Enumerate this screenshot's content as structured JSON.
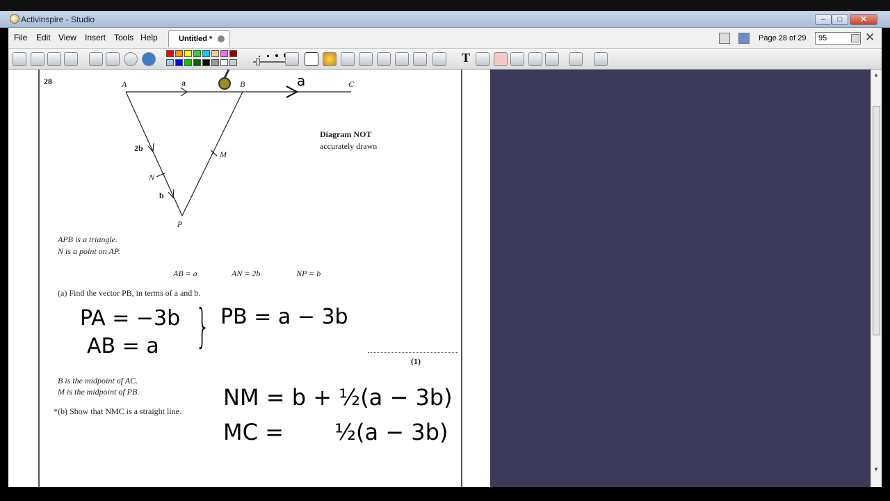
{
  "window": {
    "title": "Activinspire - Studio"
  },
  "menu": {
    "items": [
      "File",
      "Edit",
      "View",
      "Insert",
      "Tools",
      "Help"
    ]
  },
  "tab": {
    "label": "Untitled *"
  },
  "pager": {
    "label": "Page 28 of 29",
    "zoom": "95"
  },
  "colors": {
    "palette": [
      "#ff0000",
      "#ff9900",
      "#ffff00",
      "#33cc33",
      "#00ccff",
      "#ffcc99",
      "#ff66ff",
      "#990000",
      "#99ccff",
      "#0000ff",
      "#00cc00",
      "#006600",
      "#000000",
      "#999999",
      "#ffffff",
      "#cccccc"
    ],
    "right_panel": "#3b3a58"
  },
  "question": {
    "number": "28",
    "points": {
      "A": "A",
      "B": "B",
      "C": "C",
      "N": "N",
      "M": "M",
      "P": "P"
    },
    "edge_labels": {
      "a": "a",
      "two_b": "2b",
      "b": "b"
    },
    "diagram_note_line1": "Diagram NOT",
    "diagram_note_line2": "accurately drawn",
    "stmt1": "APB is a triangle.",
    "stmt2": "N is a point on AP.",
    "vectors": [
      "AB = a",
      "AN = 2b",
      "NP = b"
    ],
    "part_a": "(a) Find the vector PB, in terms of a and b.",
    "mark_a": "(1)",
    "stmt3": "B is the midpoint of AC.",
    "stmt4": "M is the midpoint of PB.",
    "part_b": "*(b) Show that NMC is a straight line."
  },
  "handwriting": {
    "diagram_a": "a",
    "line1": "PA = −3b",
    "line2": "AB = a",
    "brace_result": "PB = a − 3b",
    "line3": "NM = b + ½(a − 3b)",
    "line4": "MC =",
    "line4_rhs": "½(a − 3b)"
  }
}
